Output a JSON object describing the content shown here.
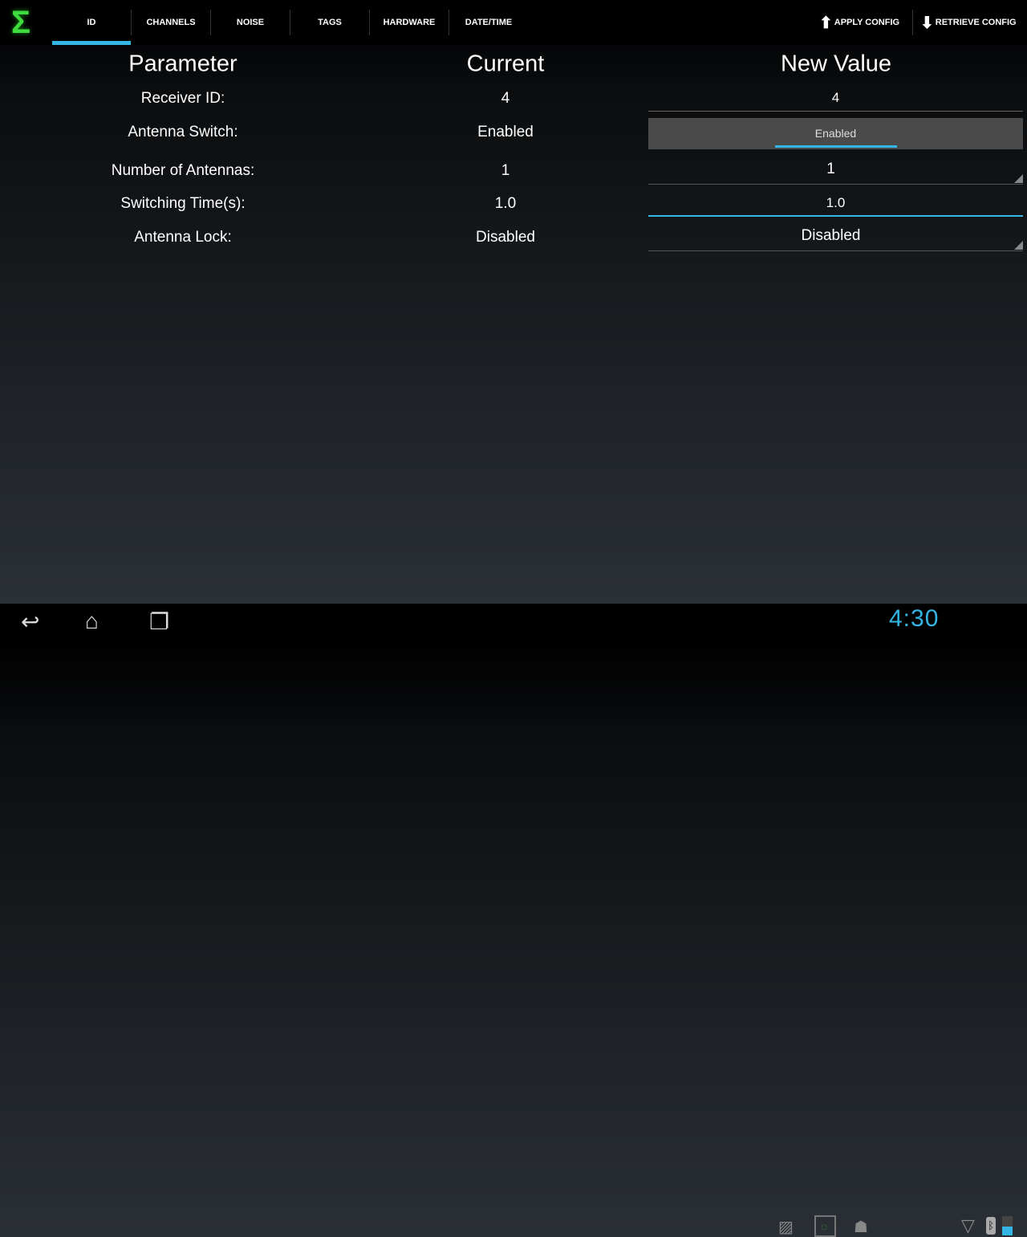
{
  "app": {
    "logo_icon": "sigma-logo-icon"
  },
  "tabs": [
    {
      "label": "ID",
      "selected": true
    },
    {
      "label": "CHANNELS"
    },
    {
      "label": "NOISE"
    },
    {
      "label": "TAGS"
    },
    {
      "label": "HARDWARE"
    },
    {
      "label": "DATE/TIME"
    }
  ],
  "actions": {
    "apply": "APPLY CONFIG",
    "retrieve": "RETRIEVE CONFIG"
  },
  "headers": {
    "parameter": "Parameter",
    "current": "Current",
    "new_value": "New Value"
  },
  "rows": [
    {
      "parameter": "Receiver ID:",
      "current": "4",
      "new_value": "4",
      "control": "text-input"
    },
    {
      "parameter": "Antenna Switch:",
      "current": "Enabled",
      "new_value": "Enabled",
      "control": "toggle"
    },
    {
      "parameter": "Number of Antennas:",
      "current": "1",
      "new_value": "1",
      "control": "spinner"
    },
    {
      "parameter": "Switching Time(s):",
      "current": "1.0",
      "new_value": "1.0",
      "control": "text-input-focused"
    },
    {
      "parameter": "Antenna Lock:",
      "current": "Disabled",
      "new_value": "Disabled",
      "control": "spinner"
    }
  ],
  "status": {
    "time": "4:30",
    "accent": "#33b5e5"
  }
}
